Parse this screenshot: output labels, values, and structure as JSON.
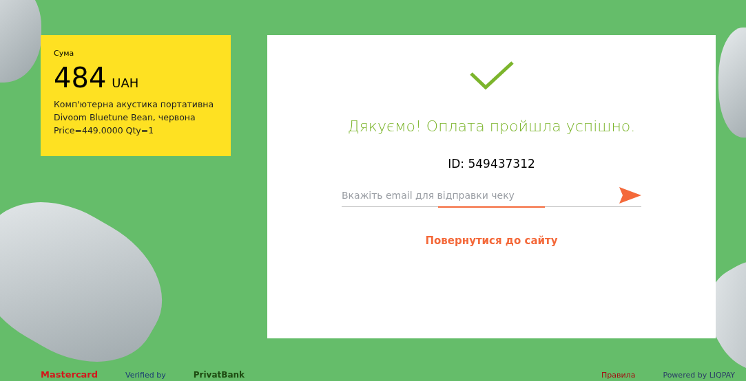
{
  "summary": {
    "label": "Сума",
    "amount": "484",
    "currency": "UAH",
    "description": "Комп'ютерна акустика портативна Divoom Bluetune Bean, червона Price=449.0000 Qty=1"
  },
  "result": {
    "message": "Дякуємо! Оплата пройшла успішно.",
    "id": "ID: 549437312",
    "email": {
      "placeholder": "Вкажіть email для відправки чеку"
    },
    "back_link": "Повернутися до сайту"
  },
  "footer": {
    "left": [
      "Mastercard",
      "Verified by",
      "PrivatBank"
    ],
    "right": [
      "Правила",
      "Powered by LIQPAY"
    ]
  }
}
